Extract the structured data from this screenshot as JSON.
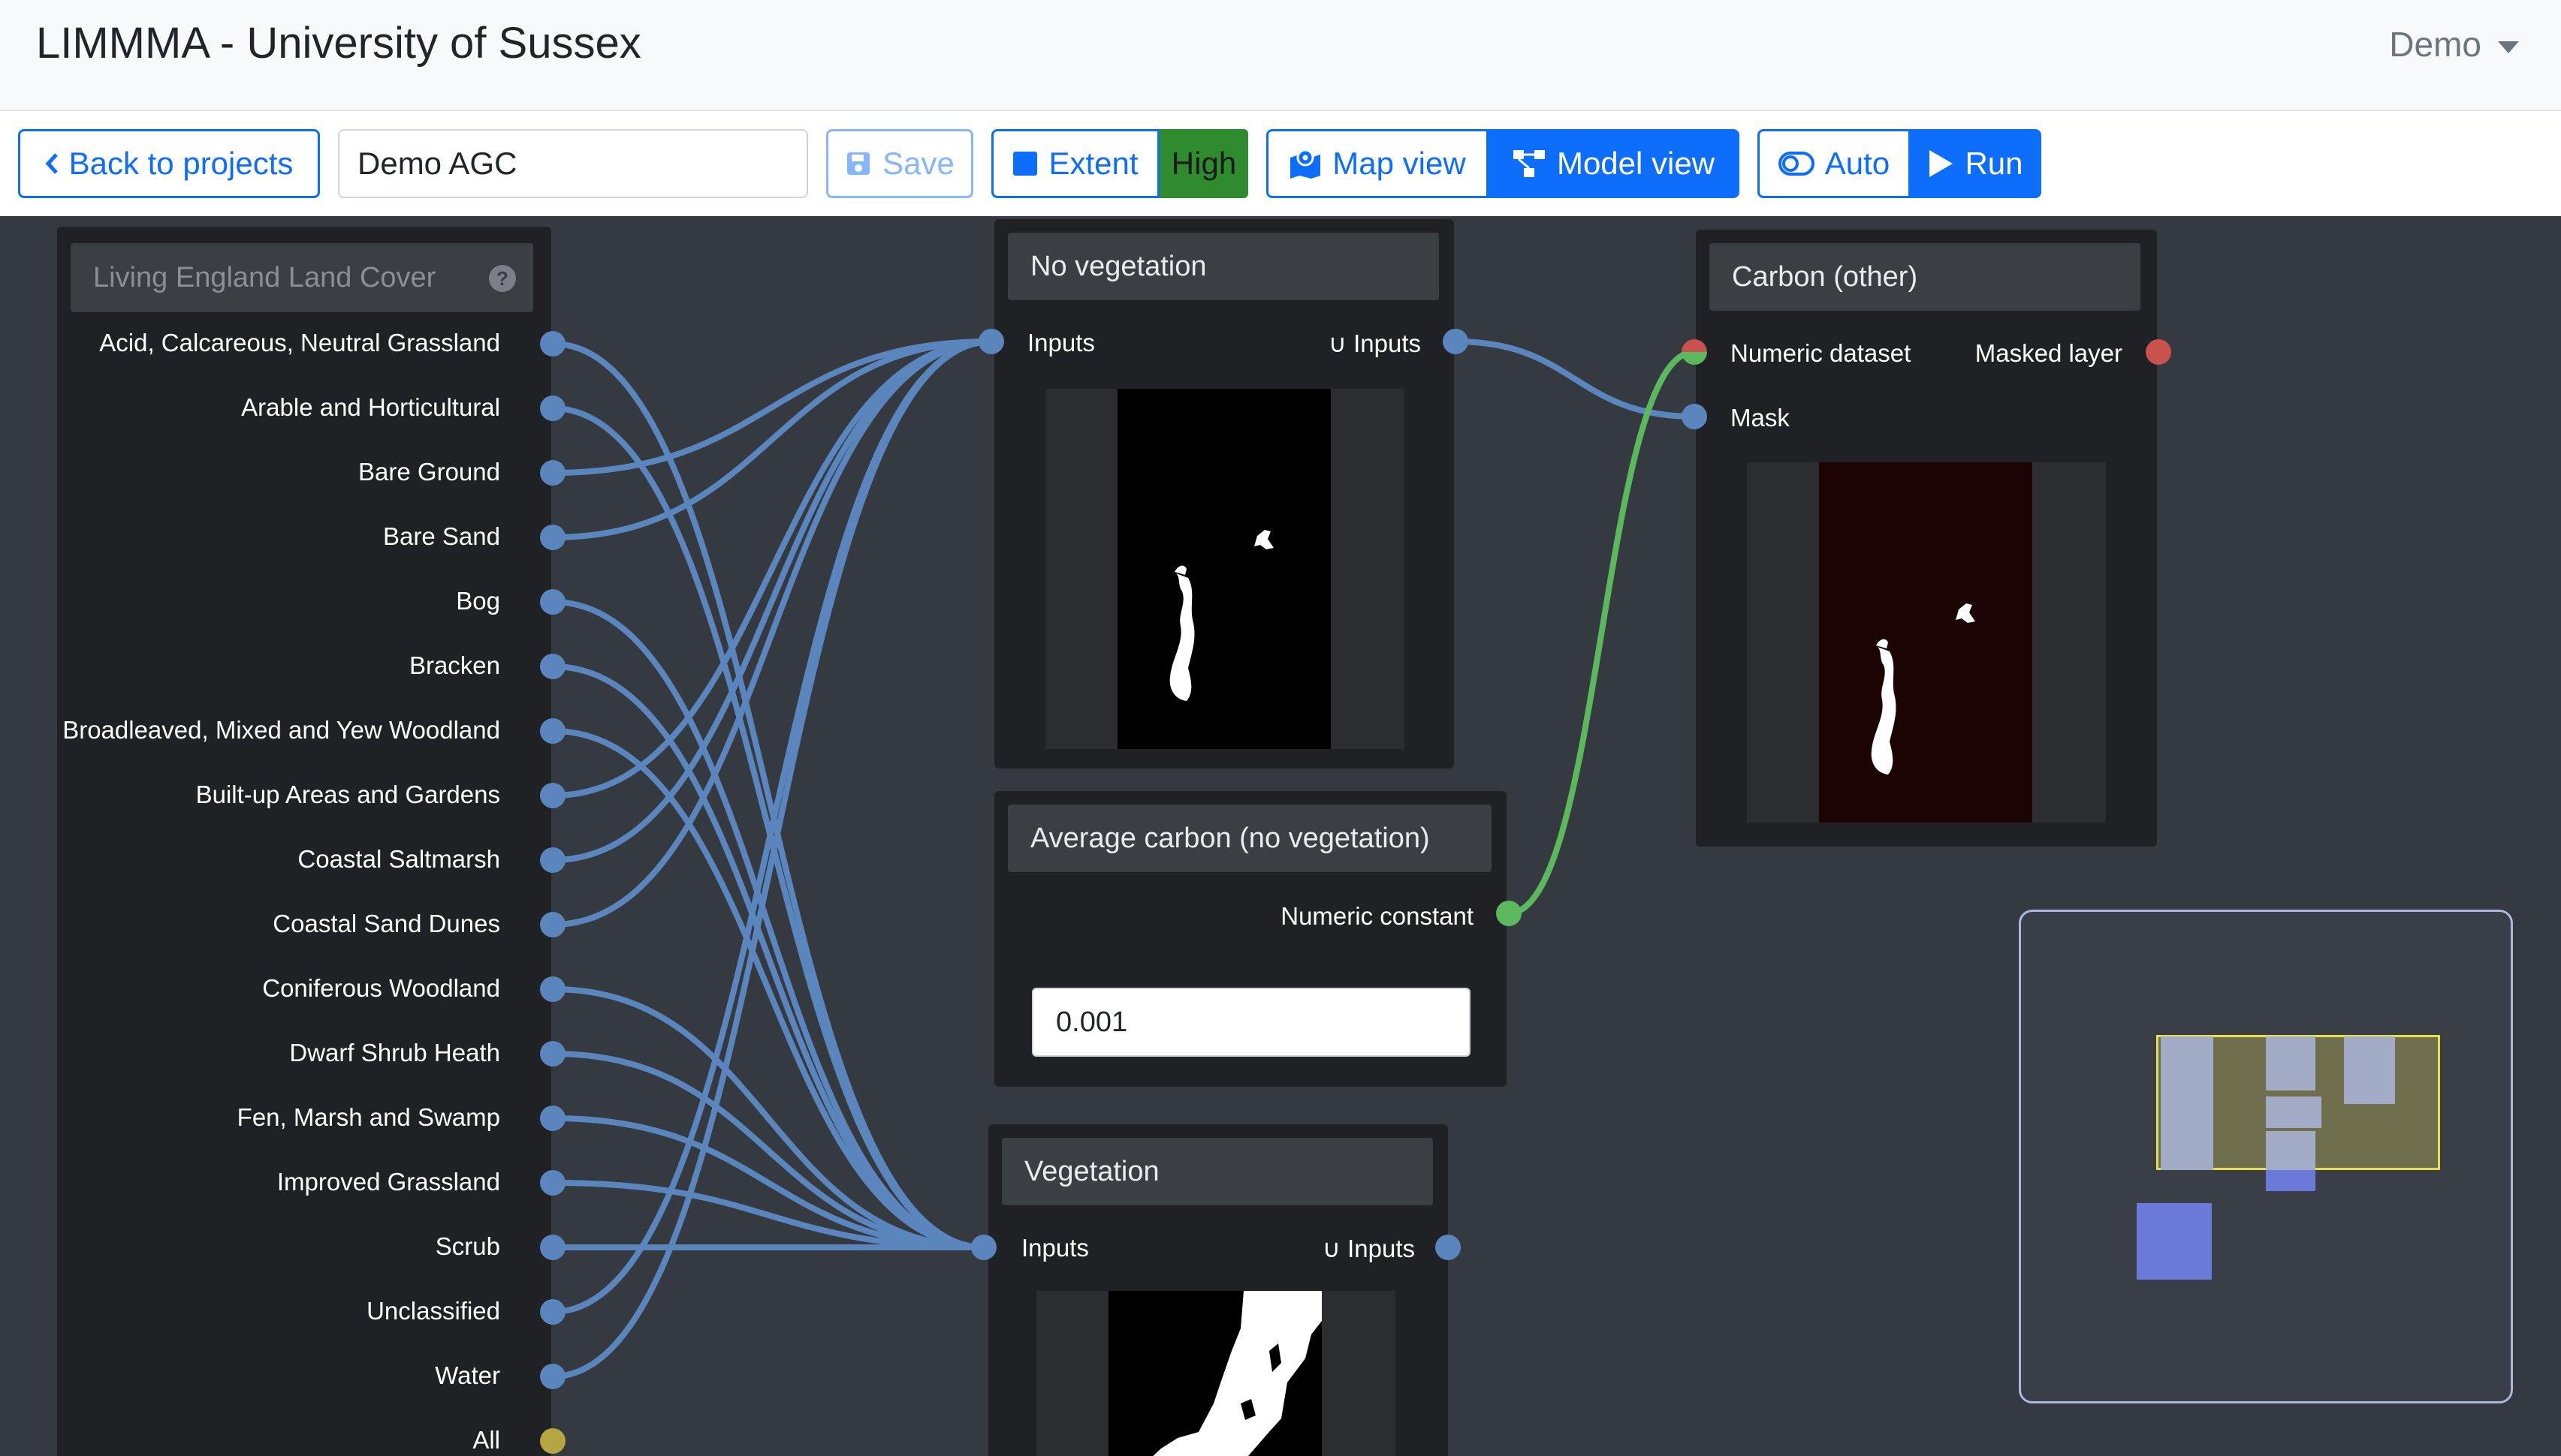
{
  "app": {
    "title": "LIMMMA - University of Sussex",
    "user": "Demo"
  },
  "toolbar": {
    "back_label": "Back to projects",
    "project_name": "Demo AGC",
    "save_label": "Save",
    "extent_label": "Extent",
    "resolution_label": "High",
    "map_view_label": "Map view",
    "model_view_label": "Model view",
    "auto_label": "Auto",
    "run_label": "Run"
  },
  "legend_node": {
    "title": "Living England Land Cover",
    "help_icon": "question-circle-icon",
    "items": [
      "Acid, Calcareous, Neutral Grassland",
      "Arable and Horticultural",
      "Bare Ground",
      "Bare Sand",
      "Bog",
      "Bracken",
      "Broadleaved, Mixed and Yew Woodland",
      "Built-up Areas and Gardens",
      "Coastal Saltmarsh",
      "Coastal Sand Dunes",
      "Coniferous Woodland",
      "Dwarf Shrub Heath",
      "Fen, Marsh and Swamp",
      "Improved Grassland",
      "Scrub",
      "Unclassified",
      "Water",
      "All"
    ]
  },
  "no_veg_node": {
    "title": "No vegetation",
    "input_label": "Inputs",
    "output_label": "∪ Inputs"
  },
  "avg_carbon_node": {
    "title": "Average carbon (no vegetation)",
    "output_label": "Numeric constant",
    "value": "0.001"
  },
  "veg_node": {
    "title": "Vegetation",
    "input_label": "Inputs",
    "output_label": "∪ Inputs"
  },
  "carbon_node": {
    "title": "Carbon (other)",
    "input1_label": "Numeric dataset",
    "input2_label": "Mask",
    "output_label": "Masked layer"
  },
  "colors": {
    "accent": "#0d6efd",
    "connection_blue": "#5b86bd",
    "connection_green": "#5cb85c",
    "port_red": "#c9514e",
    "port_all": "#b5a642",
    "resolution_bg": "#2e8b2e"
  }
}
